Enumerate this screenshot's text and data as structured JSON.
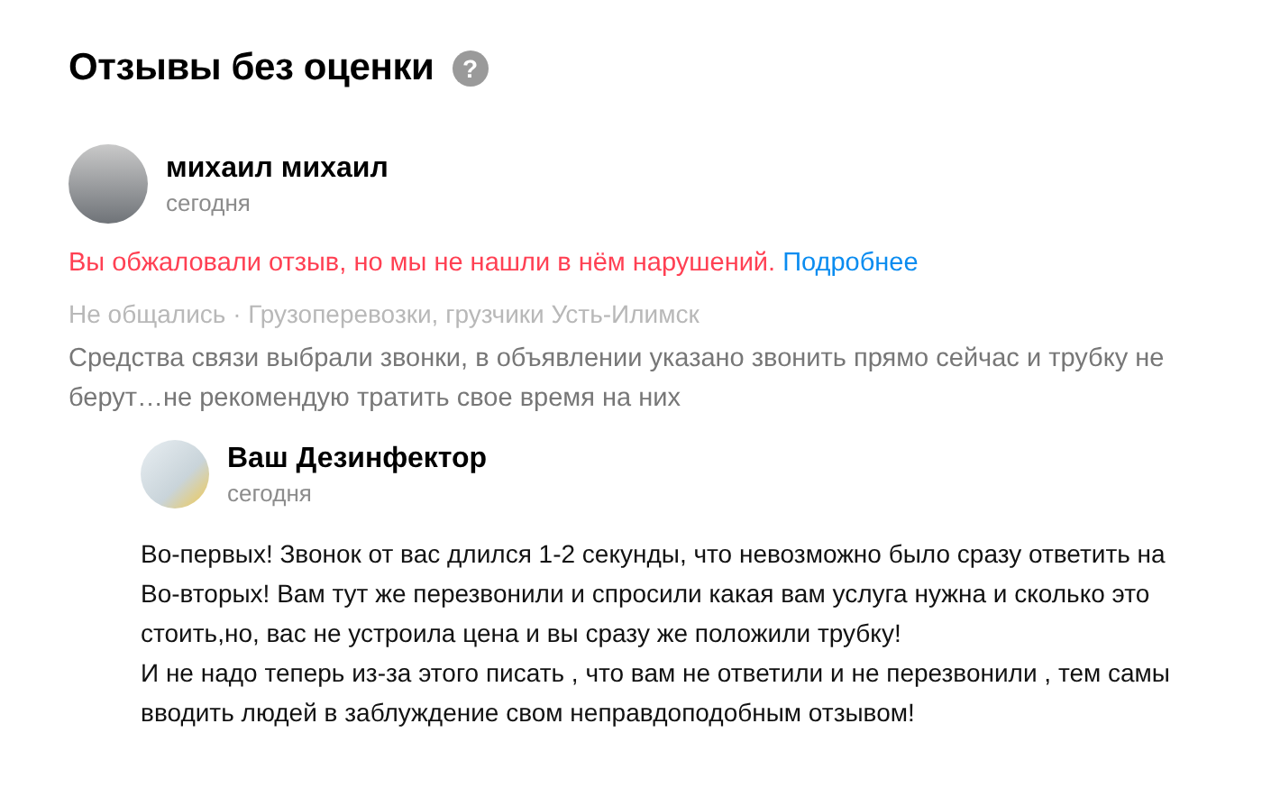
{
  "title": "Отзывы без оценки",
  "help_icon": "?",
  "review": {
    "author": "михаил михаил",
    "date": "сегодня",
    "notice": "Вы обжаловали отзыв, но мы не нашли в нём нарушений.",
    "notice_link": "Подробнее",
    "meta": "Не общались · Грузоперевозки, грузчики Усть-Илимск",
    "text": "Средства связи выбрали звонки, в объявлении указано звонить прямо сейчас и трубку не берут…не рекомендую тратить свое время на них"
  },
  "reply": {
    "author": "Ваш Дезинфектор",
    "date": "сегодня",
    "lines": [
      "Во-первых! Звонок от вас длился 1-2 секунды, что невозможно было сразу ответить на",
      "Во-вторых! Вам тут же перезвонили и спросили какая вам услуга нужна и сколько это",
      "стоить,но, вас не устроила цена и вы сразу же положили трубку!",
      "И не надо теперь из-за этого писать , что вам не ответили и не перезвонили , тем самы",
      "вводить людей в заблуждение свом неправдоподобным отзывом!"
    ]
  }
}
